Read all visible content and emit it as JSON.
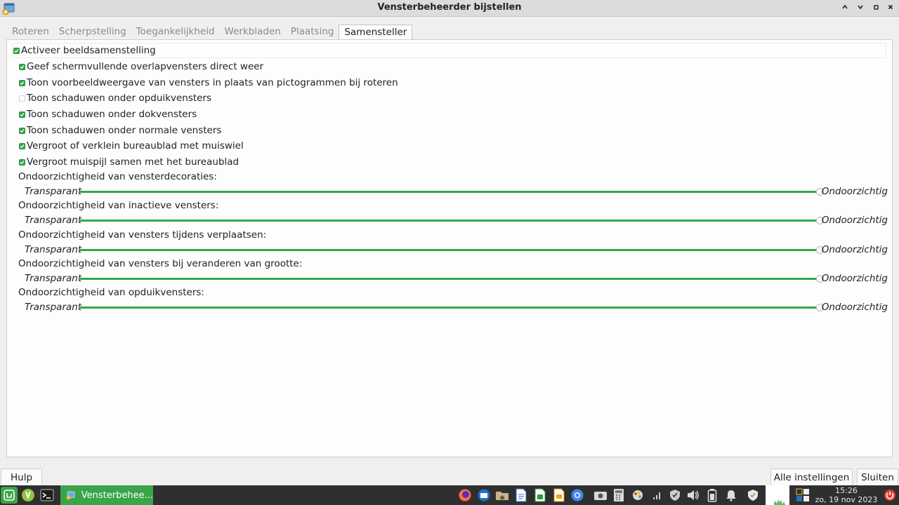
{
  "window": {
    "title": "Vensterbeheerder bijstellen",
    "controls": [
      "minimize",
      "maximize",
      "close"
    ]
  },
  "tabs": [
    {
      "label": "Roteren",
      "active": false
    },
    {
      "label": "Scherpstelling",
      "active": false
    },
    {
      "label": "Toegankelijkheid",
      "active": false
    },
    {
      "label": "Werkbladen",
      "active": false
    },
    {
      "label": "Plaatsing",
      "active": false
    },
    {
      "label": "Samensteller",
      "active": true
    }
  ],
  "compositor": {
    "enable": {
      "label": "Activeer beeldsamenstelling",
      "checked": true
    },
    "options": [
      {
        "label": "Geef schermvullende overlapvensters direct weer",
        "checked": true
      },
      {
        "label": "Toon voorbeeldweergave van vensters in plaats van pictogrammen bij roteren",
        "checked": true
      },
      {
        "label": "Toon schaduwen onder opduikvensters",
        "checked": false
      },
      {
        "label": "Toon schaduwen onder dokvensters",
        "checked": true
      },
      {
        "label": "Toon schaduwen onder normale vensters",
        "checked": true
      },
      {
        "label": "Vergroot of verklein bureaublad met muiswiel",
        "checked": true
      },
      {
        "label": "Vergroot muispijl samen met het bureaublad",
        "checked": true
      }
    ],
    "sliders": [
      {
        "label": "Ondoorzichtigheid van vensterdecoraties:",
        "min_label": "Transparant",
        "max_label": "Ondoorzichtig",
        "value": 1.0
      },
      {
        "label": "Ondoorzichtigheid van inactieve vensters:",
        "min_label": "Transparant",
        "max_label": "Ondoorzichtig",
        "value": 1.0
      },
      {
        "label": "Ondoorzichtigheid van vensters tijdens verplaatsen:",
        "min_label": "Transparant",
        "max_label": "Ondoorzichtig",
        "value": 1.0
      },
      {
        "label": "Ondoorzichtigheid van vensters bij veranderen van grootte:",
        "min_label": "Transparant",
        "max_label": "Ondoorzichtig",
        "value": 1.0
      },
      {
        "label": "Ondoorzichtigheid van opduikvensters:",
        "min_label": "Transparant",
        "max_label": "Ondoorzichtig",
        "value": 1.0
      }
    ]
  },
  "buttons": {
    "help": "Hulp",
    "all_settings": "Alle instellingen",
    "close": "Sluiten"
  },
  "taskbar": {
    "window_label": "Vensterbehee...",
    "time": "15:26",
    "date": "zo, 19 nov 2023"
  },
  "colors": {
    "accent": "#35a64d",
    "taskbar": "#2f2f2f"
  }
}
